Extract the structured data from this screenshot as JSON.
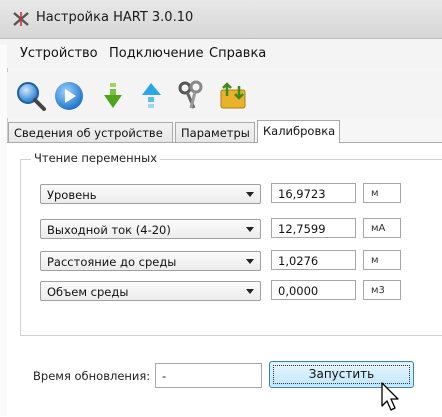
{
  "window": {
    "title": "Настройка HART 3.0.10"
  },
  "menu": [
    "Устройство",
    "Подключение",
    "Справка"
  ],
  "toolbar": [
    {
      "icon": "search-icon"
    },
    {
      "icon": "play-icon"
    },
    {
      "icon": "download-arrow-icon"
    },
    {
      "icon": "upload-arrow-icon"
    },
    {
      "icon": "keys-icon"
    },
    {
      "icon": "exchange-folder-icon"
    }
  ],
  "tabs": [
    {
      "label": "Сведения об устройстве",
      "active": false
    },
    {
      "label": "Параметры",
      "active": false
    },
    {
      "label": "Калибровка",
      "active": true
    }
  ],
  "group": {
    "title": "Чтение переменных"
  },
  "variables": [
    {
      "name": "Уровень",
      "value": "16,9723",
      "unit": "м"
    },
    {
      "name": "Выходной ток (4-20)",
      "value": "12,7599",
      "unit": "мА"
    },
    {
      "name": "Расстояние до среды",
      "value": "1,0276",
      "unit": "м"
    },
    {
      "name": "Объем среды",
      "value": "0,0000",
      "unit": "м3"
    }
  ],
  "update": {
    "label": "Время обновления:",
    "value": "-"
  },
  "start_button": {
    "label": "Запустить"
  },
  "colors": {
    "accent": "#3c7fb1",
    "button_fill": "#bee6fd"
  }
}
